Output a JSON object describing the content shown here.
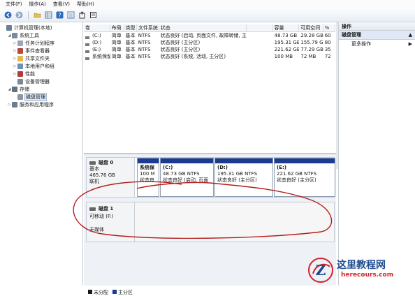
{
  "menu": [
    "文件(F)",
    "操作(A)",
    "查看(V)",
    "帮助(H)"
  ],
  "toolbar": {
    "buttons": [
      "back-icon",
      "forward-icon",
      "folder-icon",
      "grid-icon",
      "help-icon",
      "list-icon",
      "export-icon",
      "properties-icon"
    ]
  },
  "tree": [
    {
      "label": "计算机管理(本地)",
      "level": 0,
      "icon": "computer-icon",
      "color": "#6b7f99",
      "exp": ""
    },
    {
      "label": "系统工具",
      "level": 1,
      "icon": "tools-icon",
      "color": "#7a8aa0",
      "exp": "◢"
    },
    {
      "label": "任务计划程序",
      "level": 2,
      "icon": "clock-icon",
      "color": "#9aa7b8",
      "exp": "▷"
    },
    {
      "label": "事件查看器",
      "level": 2,
      "icon": "event-icon",
      "color": "#b34a3c",
      "exp": "▷"
    },
    {
      "label": "共享文件夹",
      "level": 2,
      "icon": "folder-icon",
      "color": "#e3b94b",
      "exp": "▷"
    },
    {
      "label": "本地用户和组",
      "level": 2,
      "icon": "users-icon",
      "color": "#6f8fb8",
      "exp": "▷"
    },
    {
      "label": "性能",
      "level": 2,
      "icon": "performance-icon",
      "color": "#b23a3a",
      "exp": "▷"
    },
    {
      "label": "设备管理器",
      "level": 2,
      "icon": "device-icon",
      "color": "#7b8896",
      "exp": ""
    },
    {
      "label": "存储",
      "level": 1,
      "icon": "storage-icon",
      "color": "#5f7289",
      "exp": "◢"
    },
    {
      "label": "磁盘管理",
      "level": 2,
      "icon": "disk-icon",
      "color": "#8c96a3",
      "exp": "",
      "selected": true
    },
    {
      "label": "服务和应用程序",
      "level": 1,
      "icon": "services-icon",
      "color": "#6c7d92",
      "exp": "▷"
    }
  ],
  "volume_table": {
    "headers": [
      "卷",
      "布局",
      "类型",
      "文件系统",
      "状态",
      "",
      "容量",
      "可用空间",
      "%"
    ],
    "rows": [
      [
        "(C:)",
        "简单",
        "基本",
        "NTFS",
        "状态良好 (启动, 页面文件, 故障转储, 主分区)",
        "",
        "48.73 GB",
        "29.28 GB",
        "60"
      ],
      [
        "(D:)",
        "简单",
        "基本",
        "NTFS",
        "状态良好 (主分区)",
        "",
        "195.31 GB",
        "155.79 GB",
        "80"
      ],
      [
        "(E:)",
        "简单",
        "基本",
        "NTFS",
        "状态良好 (主分区)",
        "",
        "221.62 GB",
        "77.29 GB",
        "35"
      ],
      [
        "系统保留",
        "简单",
        "基本",
        "NTFS",
        "状态良好 (系统, 活动, 主分区)",
        "",
        "100 MB",
        "72 MB",
        "72"
      ]
    ]
  },
  "disks": [
    {
      "name": "磁盘 0",
      "type": "基本",
      "size": "465.76 GB",
      "status": "联机",
      "partitions": [
        {
          "title": "系统保",
          "size": "100 M",
          "status": "状态良"
        },
        {
          "title": "(C:)",
          "size": "48.73 GB NTFS",
          "status": "状态良好 (启动, 页面"
        },
        {
          "title": "(D:)",
          "size": "195.31 GB NTFS",
          "status": "状态良好 (主分区)"
        },
        {
          "title": "(E:)",
          "size": "221.62 GB NTFS",
          "status": "状态良好 (主分区)"
        }
      ]
    },
    {
      "name": "磁盘 1",
      "type": "可移动 (F:)",
      "status": "无媒体"
    }
  ],
  "legend": [
    {
      "label": "未分配",
      "color": "#1a1a1a"
    },
    {
      "label": "主分区",
      "color": "#1a3b8f"
    }
  ],
  "actions": {
    "header": "操作",
    "section": "磁盘管理",
    "items": [
      "更多操作"
    ]
  },
  "watermark": {
    "cn": "这里教程网",
    "en": "herecours.com"
  },
  "colors": {
    "partition_bar": "#1a3b8f",
    "annotation_circle": "#b51c1c",
    "selection": "#dce8f6"
  }
}
